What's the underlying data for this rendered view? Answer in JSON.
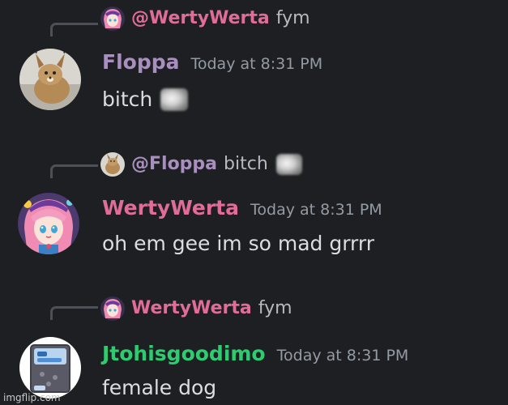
{
  "colors": {
    "background": "#1e1f22",
    "floppa_name": "#a88fbf",
    "werty_name": "#e06c9a",
    "jtoh_name": "#2ecc71",
    "message_text": "#dbdee1",
    "timestamp": "#949ba4"
  },
  "messages": [
    {
      "reply": {
        "mention": "@WertyWerta",
        "text": "fym",
        "avatar_icon": "anime-girl-avatar-icon"
      },
      "username": "Floppa",
      "timestamp": "Today at 8:31 PM",
      "content": "bitch",
      "avatar_icon": "caracal-cat-avatar-icon",
      "content_emoji": "blurred-face-emoji-icon"
    },
    {
      "reply": {
        "mention": "@Floppa",
        "text": "bitch",
        "avatar_icon": "caracal-cat-avatar-icon",
        "emoji": "blurred-face-emoji-icon"
      },
      "username": "WertyWerta",
      "timestamp": "Today at 8:31 PM",
      "content": "oh em gee im so mad grrrr",
      "avatar_icon": "anime-girl-avatar-icon"
    },
    {
      "reply": {
        "mention": "WertyWerta",
        "text": "fym",
        "avatar_icon": "anime-girl-avatar-icon"
      },
      "username": "Jtohisgoodimo",
      "timestamp": "Today at 8:31 PM",
      "content": "female dog",
      "avatar_icon": "diaper-package-avatar-icon"
    }
  ],
  "watermark": "imgflip.com"
}
